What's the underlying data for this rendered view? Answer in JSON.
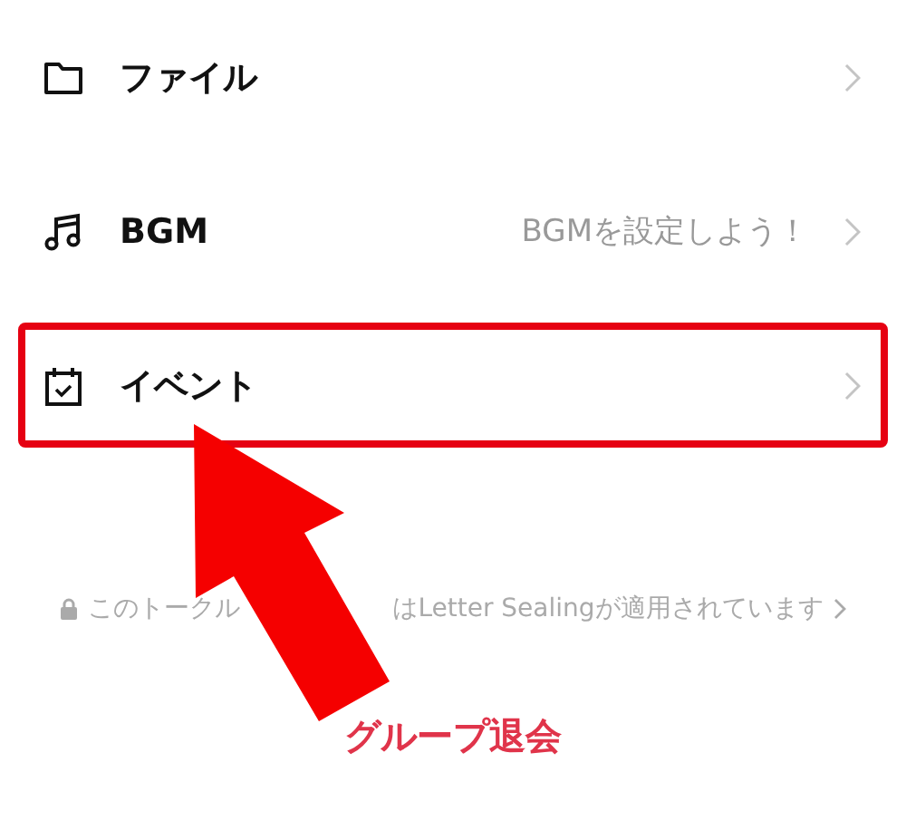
{
  "rows": [
    {
      "label": "ファイル",
      "value": "",
      "highlighted": false
    },
    {
      "label": "BGM",
      "value": "BGMを設定しよう！",
      "highlighted": false
    },
    {
      "label": "イベント",
      "value": "",
      "highlighted": true
    }
  ],
  "footer": {
    "text_before": "このトークル",
    "text_after": "はLetter Sealingが適用されています"
  },
  "annotation": {
    "label": "グループ退会"
  }
}
